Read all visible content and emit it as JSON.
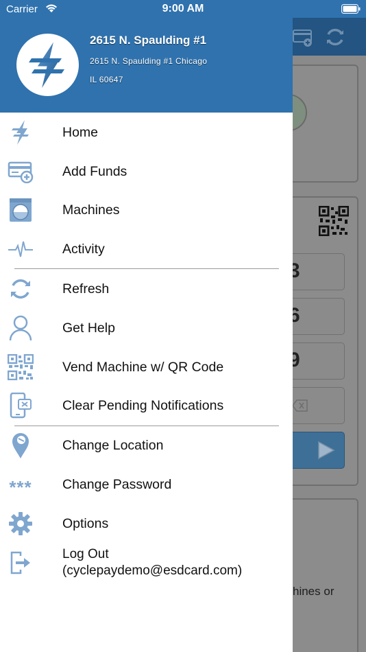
{
  "status_bar": {
    "carrier": "Carrier",
    "time": "9:00 AM"
  },
  "header": {
    "location_name": "2615 N. Spaulding #1",
    "address_line": "2615 N. Spaulding #1 Chicago",
    "state_zip": "IL  60647"
  },
  "menu": {
    "home": "Home",
    "add_funds": "Add Funds",
    "machines": "Machines",
    "activity": "Activity",
    "refresh": "Refresh",
    "get_help": "Get Help",
    "vend_qr": "Vend Machine w/ QR Code",
    "clear_notifications": "Clear Pending Notifications",
    "change_location": "Change Location",
    "change_password": "Change Password",
    "options": "Options",
    "log_out": "Log Out",
    "log_out_email": "(cyclepaydemo@esdcard.com)",
    "password_glyph": "***"
  },
  "background": {
    "digit_1": "3",
    "digit_2": "6",
    "digit_3": "9",
    "partial_text": "hines or"
  },
  "colors": {
    "brand_blue": "#2f72ae",
    "icon_blue": "#7fa6cf",
    "overlay_gray": "#8a8a8a"
  }
}
